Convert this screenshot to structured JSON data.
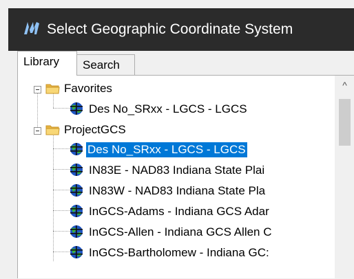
{
  "window": {
    "title": "Select Geographic Coordinate System",
    "icon": "microstation-logo-icon"
  },
  "tabs": [
    {
      "label": "Library",
      "active": true
    },
    {
      "label": "Search",
      "active": false
    }
  ],
  "tree": {
    "folders": [
      {
        "label": "Favorites",
        "expanded": true,
        "items": [
          {
            "label": "Des No_SRxx - LGCS - LGCS",
            "selected": false
          }
        ]
      },
      {
        "label": "ProjectGCS",
        "expanded": true,
        "items": [
          {
            "label": "Des No_SRxx - LGCS - LGCS",
            "selected": true
          },
          {
            "label": "IN83E - NAD83 Indiana State Plai",
            "selected": false
          },
          {
            "label": "IN83W - NAD83 Indiana State Pla",
            "selected": false
          },
          {
            "label": "InGCS-Adams - Indiana GCS Adar",
            "selected": false
          },
          {
            "label": "InGCS-Allen - Indiana GCS Allen C",
            "selected": false
          },
          {
            "label": "InGCS-Bartholomew - Indiana GC:",
            "selected": false
          }
        ]
      }
    ]
  },
  "scrollbar": {
    "up_glyph": "^"
  },
  "colors": {
    "titlebar": "#2b2b2b",
    "selection": "#0078d7",
    "folder": "#f5c75b",
    "globe_green": "#2e9e2e",
    "globe_blue": "#1a4fb5"
  }
}
